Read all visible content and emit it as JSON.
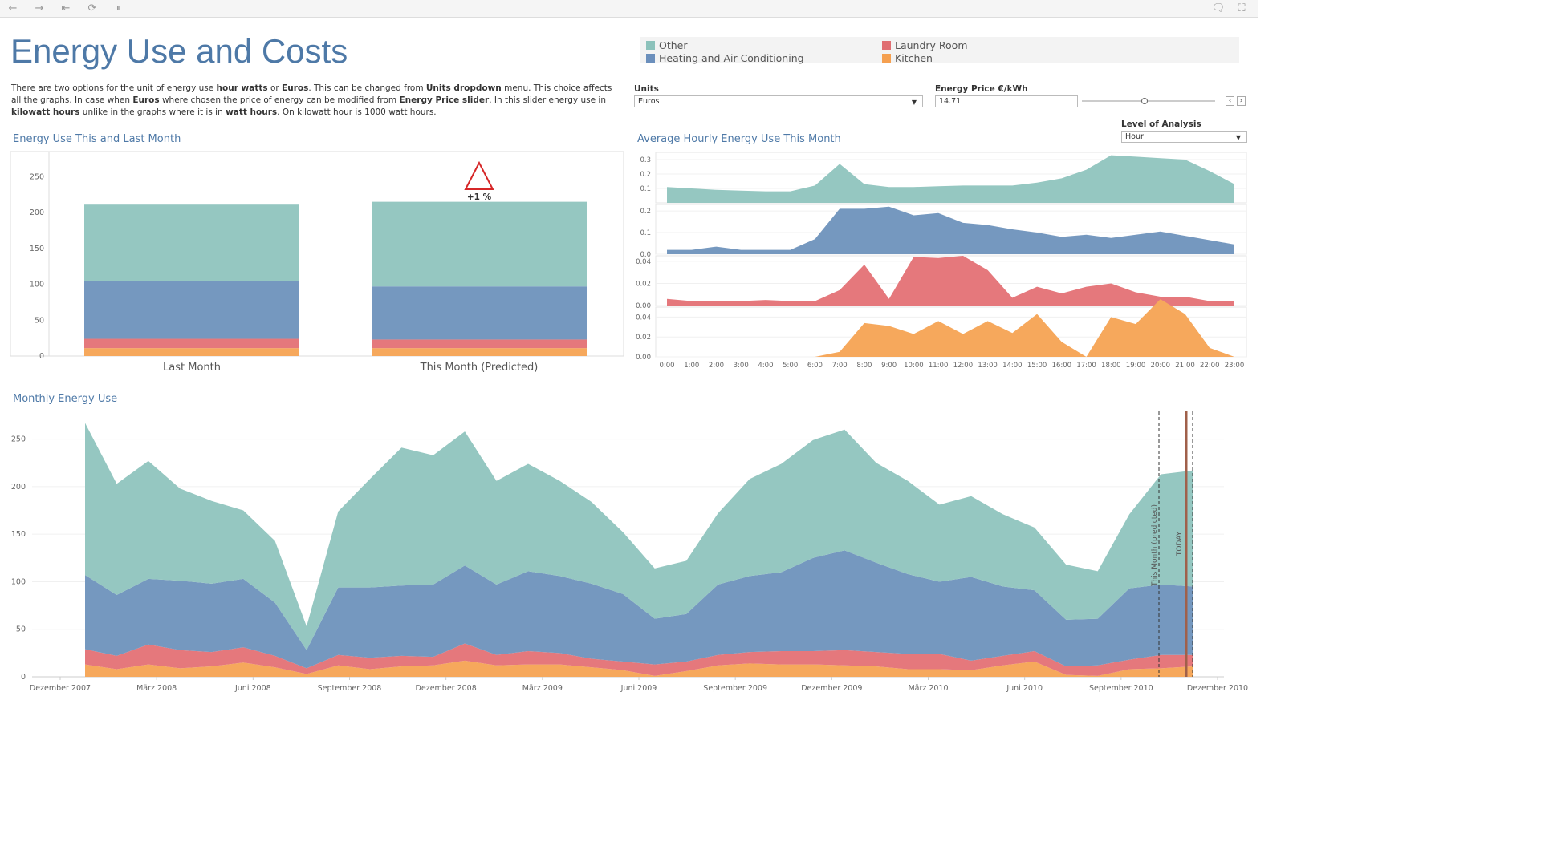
{
  "toolbar": {
    "buttons": [
      {
        "name": "back-icon",
        "glyph": "←"
      },
      {
        "name": "forward-icon",
        "glyph": "→"
      },
      {
        "name": "revert-icon",
        "glyph": "⇤"
      },
      {
        "name": "refresh-icon",
        "glyph": "⟳"
      },
      {
        "name": "pause-icon",
        "glyph": "⏸"
      }
    ],
    "right_buttons": [
      {
        "name": "comment-icon",
        "glyph": "🗨"
      },
      {
        "name": "fullscreen-icon",
        "glyph": "⛶"
      }
    ]
  },
  "page": {
    "title": "Energy Use and Costs",
    "description": [
      {
        "t": "There are two options for the unit of energy use "
      },
      {
        "t": "hour watts",
        "b": true
      },
      {
        "t": " or "
      },
      {
        "t": "Euros",
        "b": true
      },
      {
        "t": ". This can be changed from "
      },
      {
        "t": "Units dropdown",
        "b": true
      },
      {
        "t": " menu. This choice affects all the graphs. In case when "
      },
      {
        "t": "Euros",
        "b": true
      },
      {
        "t": " where chosen the price of energy can be modified from "
      },
      {
        "t": "Energy Price slider",
        "b": true
      },
      {
        "t": ". In this slider energy use in "
      },
      {
        "t": "kilowatt hours",
        "b": true
      },
      {
        "t": " unlike in the graphs where it is in "
      },
      {
        "t": "watt hours",
        "b": true
      },
      {
        "t": ". On kilowatt hour is 1000 watt hours."
      }
    ]
  },
  "legend": {
    "items": [
      {
        "label": "Other",
        "color": "#8cc2bb"
      },
      {
        "label": "Laundry Room",
        "color": "#e06e72"
      },
      {
        "label": "Heating and Air Conditioning",
        "color": "#6b8fbc"
      },
      {
        "label": "Kitchen",
        "color": "#f5a050"
      }
    ]
  },
  "controls": {
    "units_label": "Units",
    "units_value": "Euros",
    "price_label": "Energy Price €/kWh",
    "price_value": "14.71",
    "price_slider_fraction": 0.47,
    "level_label": "Level of Analysis",
    "level_value": "Hour"
  },
  "colors": {
    "other": "#95c7c1",
    "heating": "#7598bf",
    "laundry": "#e5787c",
    "kitchen": "#f6a85c",
    "title": "#4e79a7",
    "indicator": "#d62728",
    "today": "#a0604a"
  },
  "chart_data": [
    {
      "id": "bars",
      "type": "bar",
      "title": "Energy Use This and Last Month",
      "categories": [
        "Last Month",
        "This Month (Predicted)"
      ],
      "series": [
        {
          "name": "Kitchen",
          "values": [
            11,
            11
          ]
        },
        {
          "name": "Laundry Room",
          "values": [
            13,
            12
          ]
        },
        {
          "name": "Heating and Air Conditioning",
          "values": [
            80,
            74
          ]
        },
        {
          "name": "Other",
          "values": [
            107,
            118
          ]
        }
      ],
      "ylim": [
        0,
        285
      ],
      "yticks": [
        0,
        50,
        100,
        150,
        200,
        250
      ],
      "annotation": "+1 %"
    },
    {
      "id": "hourly",
      "type": "area",
      "title": "Average Hourly Energy Use This Month",
      "x": [
        "0:00",
        "1:00",
        "2:00",
        "3:00",
        "4:00",
        "5:00",
        "6:00",
        "7:00",
        "8:00",
        "9:00",
        "10:00",
        "11:00",
        "12:00",
        "13:00",
        "14:00",
        "15:00",
        "16:00",
        "17:00",
        "18:00",
        "19:00",
        "20:00",
        "21:00",
        "22:00",
        "23:00"
      ],
      "panels": [
        {
          "name": "Other",
          "ylim": [
            0,
            0.35
          ],
          "yticks": [
            0.1,
            0.2,
            0.3
          ],
          "values": [
            0.11,
            0.1,
            0.09,
            0.085,
            0.08,
            0.08,
            0.12,
            0.27,
            0.13,
            0.11,
            0.11,
            0.115,
            0.12,
            0.12,
            0.12,
            0.14,
            0.17,
            0.23,
            0.33,
            0.32,
            0.31,
            0.3,
            0.22,
            0.13
          ]
        },
        {
          "name": "Heating and Air Conditioning",
          "ylim": [
            0,
            0.23
          ],
          "yticks": [
            0.0,
            0.1,
            0.2
          ],
          "values": [
            0.02,
            0.02,
            0.035,
            0.02,
            0.02,
            0.02,
            0.07,
            0.21,
            0.21,
            0.22,
            0.18,
            0.19,
            0.145,
            0.135,
            0.115,
            0.1,
            0.08,
            0.09,
            0.075,
            0.09,
            0.105,
            0.085,
            0.065,
            0.045
          ]
        },
        {
          "name": "Laundry Room",
          "ylim": [
            0,
            0.045
          ],
          "yticks": [
            0.0,
            0.02,
            0.04
          ],
          "values": [
            0.006,
            0.004,
            0.004,
            0.004,
            0.005,
            0.004,
            0.004,
            0.014,
            0.037,
            0.006,
            0.044,
            0.043,
            0.045,
            0.032,
            0.007,
            0.017,
            0.011,
            0.017,
            0.02,
            0.012,
            0.008,
            0.008,
            0.004,
            0.004
          ]
        },
        {
          "name": "Kitchen",
          "ylim": [
            0,
            0.05
          ],
          "yticks": [
            0.0,
            0.02,
            0.04
          ],
          "values": [
            0,
            0,
            0,
            0,
            0,
            0,
            0,
            0.005,
            0.034,
            0.031,
            0.023,
            0.036,
            0.023,
            0.036,
            0.024,
            0.043,
            0.015,
            0.0,
            0.04,
            0.033,
            0.058,
            0.043,
            0.009,
            0.0
          ]
        }
      ]
    },
    {
      "id": "monthly",
      "type": "area",
      "title": "Monthly Energy Use",
      "x_labels": [
        "Dezember 2007",
        "März 2008",
        "Juni 2008",
        "September 2008",
        "Dezember 2008",
        "März 2009",
        "Juni 2009",
        "September 2009",
        "Dezember 2009",
        "März 2010",
        "Juni 2010",
        "September 2010",
        "Dezember 2010"
      ],
      "series": [
        {
          "name": "Kitchen",
          "values": [
            13,
            8,
            13,
            9,
            11,
            15,
            10,
            3,
            12,
            8,
            11,
            12,
            17,
            12,
            13,
            13,
            10,
            7,
            1,
            6,
            12,
            14,
            13,
            13,
            12,
            11,
            8,
            8,
            7,
            12,
            16,
            2,
            1,
            8,
            9,
            11
          ]
        },
        {
          "name": "Laundry Room",
          "values": [
            16,
            14,
            21,
            19,
            15,
            16,
            12,
            6,
            11,
            12,
            11,
            9,
            18,
            11,
            14,
            12,
            9,
            9,
            12,
            10,
            11,
            12,
            14,
            14,
            16,
            15,
            16,
            16,
            10,
            10,
            11,
            9,
            11,
            10,
            14,
            12
          ]
        },
        {
          "name": "Heating and Air Conditioning",
          "values": [
            78,
            64,
            69,
            73,
            72,
            72,
            56,
            19,
            71,
            74,
            74,
            76,
            82,
            74,
            84,
            81,
            79,
            71,
            48,
            50,
            74,
            80,
            83,
            98,
            105,
            94,
            84,
            76,
            88,
            73,
            64,
            49,
            49,
            75,
            74,
            72
          ]
        },
        {
          "name": "Other",
          "values": [
            160,
            117,
            124,
            97,
            87,
            72,
            65,
            25,
            80,
            114,
            145,
            136,
            141,
            109,
            113,
            100,
            86,
            65,
            53,
            56,
            75,
            102,
            114,
            124,
            127,
            105,
            98,
            81,
            85,
            76,
            66,
            58,
            50,
            78,
            116,
            122
          ]
        }
      ],
      "ylim": [
        0,
        275
      ],
      "yticks": [
        0,
        50,
        100,
        150,
        200,
        250
      ],
      "markers": [
        "This Month (predicted)",
        "TODAY"
      ]
    }
  ]
}
